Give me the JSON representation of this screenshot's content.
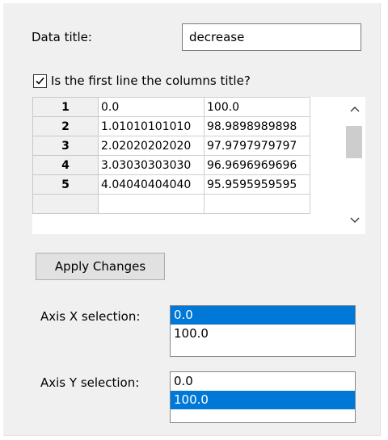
{
  "form": {
    "data_title_label": "Data title:",
    "data_title_value": "decrease",
    "first_line_checkbox_label": "Is the first line the columns title?",
    "first_line_checked": true
  },
  "grid": {
    "rows": [
      {
        "index": "1",
        "col1": "0.0",
        "col2": "100.0"
      },
      {
        "index": "2",
        "col1": "1.01010101010",
        "col2": "98.9898989898"
      },
      {
        "index": "3",
        "col1": "2.02020202020",
        "col2": "97.9797979797"
      },
      {
        "index": "4",
        "col1": "3.03030303030",
        "col2": "96.9696969696"
      },
      {
        "index": "5",
        "col1": "4.04040404040",
        "col2": "95.9595959595"
      }
    ]
  },
  "buttons": {
    "apply_label": "Apply Changes"
  },
  "axis_x": {
    "label": "Axis X selection:",
    "options": [
      "0.0",
      "100.0"
    ],
    "selected": "0.0"
  },
  "axis_y": {
    "label": "Axis Y selection:",
    "options": [
      "0.0",
      "100.0"
    ],
    "selected": "100.0"
  },
  "colors": {
    "selection": "#0078d7",
    "panel": "#f0f0f0"
  },
  "icons": {
    "checkbox": "checkmark-icon",
    "scroll_up": "chevron-up-icon",
    "scroll_down": "chevron-down-icon"
  }
}
